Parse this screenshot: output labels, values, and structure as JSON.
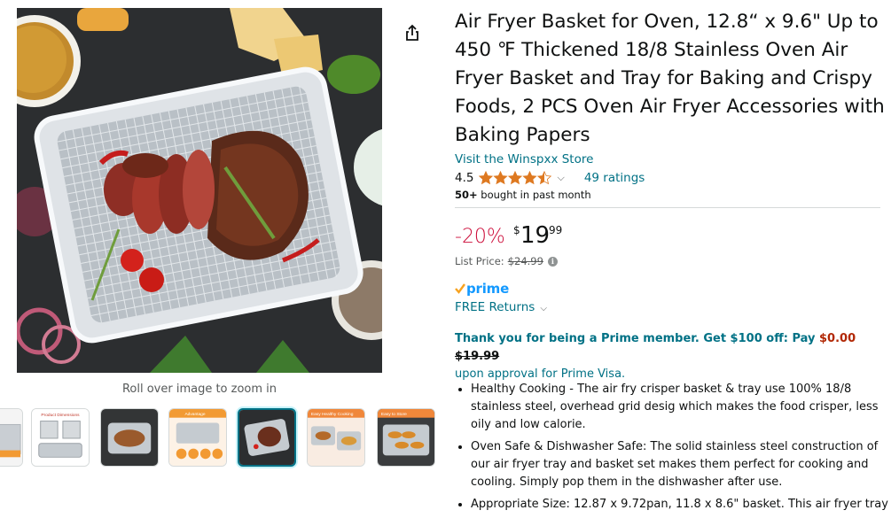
{
  "product": {
    "title": "Air Fryer Basket for Oven, 12.8“ x 9.6\" Up to 450 ℉ Thickened 18/8 Stainless Oven Air Fryer Basket and Tray for Baking and Crispy Foods, 2 PCS Oven Air Fryer Accessories with Baking Papers",
    "store_link": "Visit the Winspxx Store",
    "rating_value": "4.5",
    "rating_fraction": 0.9,
    "ratings_count": "49 ratings",
    "bought_bold": "50+",
    "bought_rest": " bought in past month"
  },
  "price": {
    "discount": "-20%",
    "symbol": "$",
    "whole": "19",
    "fraction": "99",
    "list_price_label": "List Price:",
    "list_price_value": "$24.99"
  },
  "prime": {
    "logo_text": "prime",
    "returns": "FREE Returns",
    "offer_lead": "Thank you for being a Prime member. Get $100 off: Pay ",
    "offer_pay": "$0.00",
    "offer_strike": "$19.99",
    "offer_tail": "upon approval for Prime Visa."
  },
  "gallery": {
    "zoom_hint": "Roll over image to zoom in",
    "thumbnails": [
      {
        "label": ""
      },
      {
        "label": "Product Dimensions"
      },
      {
        "label": ""
      },
      {
        "label": "Advantage"
      },
      {
        "label": ""
      },
      {
        "label": "Easy Healthy Cooking"
      },
      {
        "label": "Easy to Store"
      }
    ],
    "active_index": 4
  },
  "bullets": [
    "Healthy Cooking - The air fry crisper basket & tray use 100% 18/8 stainless steel, overhead grid desig which makes the food crisper, less oily and low calorie.",
    "Oven Safe & Dishwasher Safe: The solid stainless steel construction of our air fryer tray and basket set makes them perfect for cooking and cooling. Simply pop them in the dishwasher after use.",
    "Appropriate Size: 12.87 x 9.72pan, 11.8 x 8.6\" basket. This air fryer tray"
  ],
  "colors": {
    "link": "#007185",
    "discount": "#cc0c39",
    "star": "#de7921",
    "prime_blue": "#1399ff",
    "prime_check": "#f7a21f",
    "offer_price": "#b12704"
  }
}
